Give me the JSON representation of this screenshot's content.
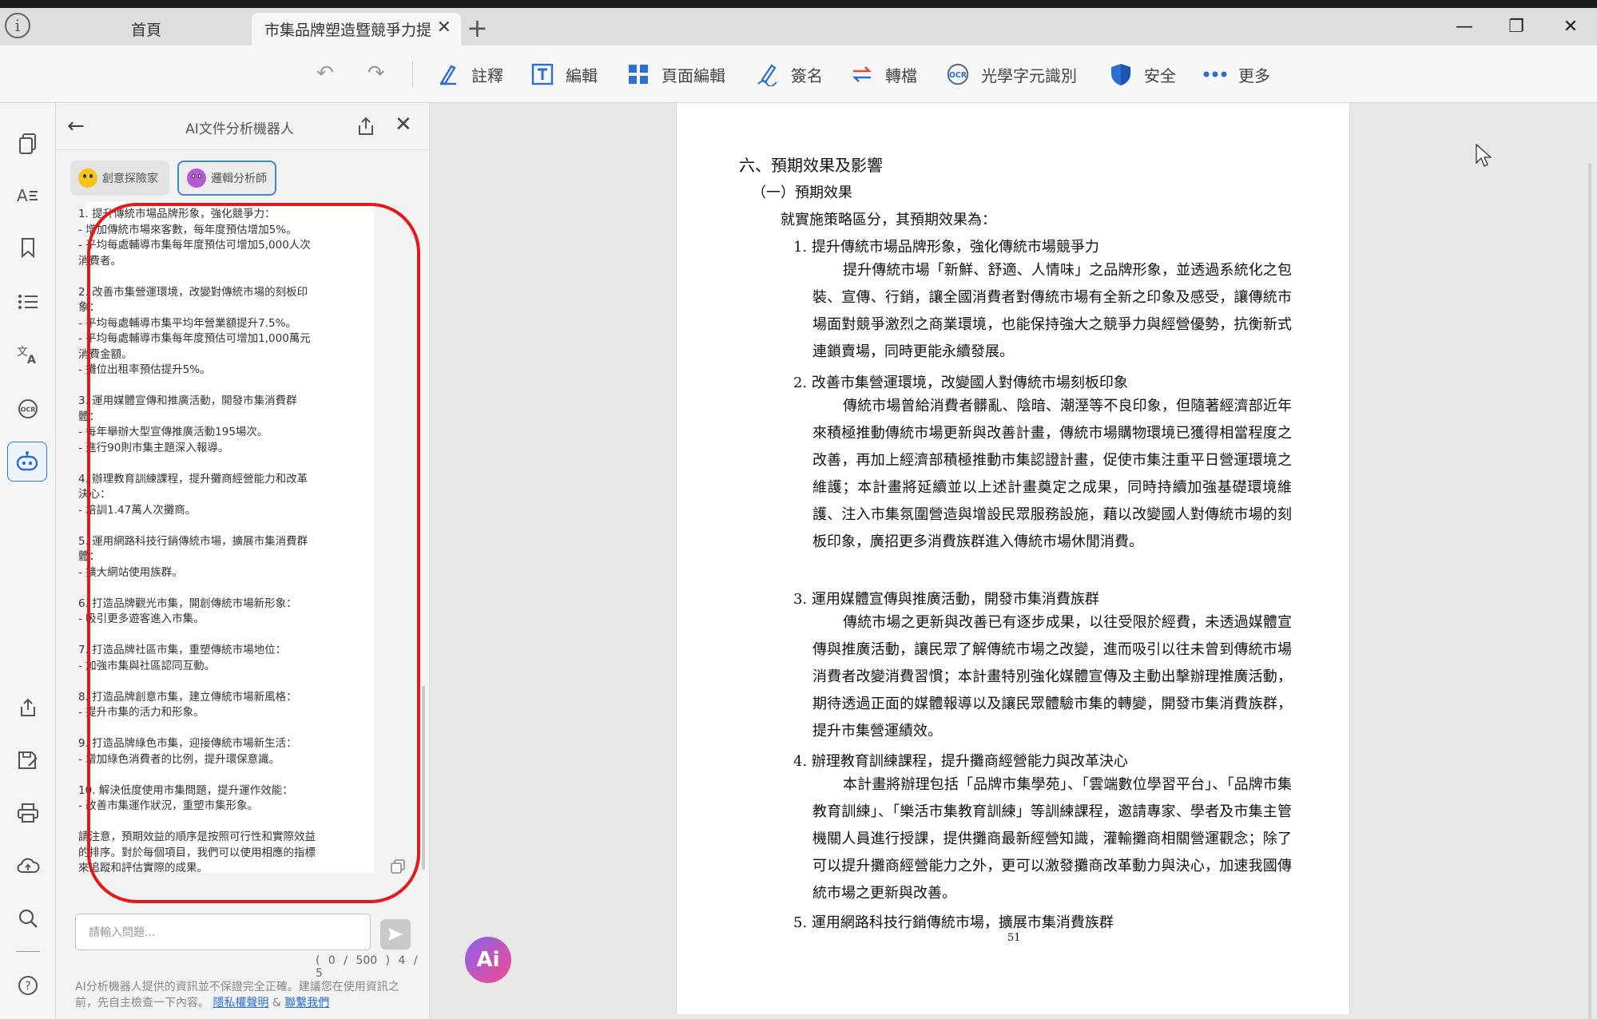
{
  "tabs": {
    "home": "首頁",
    "active": "市集品牌塑造暨競爭力提...",
    "add": "+",
    "close": "✕"
  },
  "window_controls": {
    "minimize": "—",
    "restore": "❐",
    "close": "✕"
  },
  "toolbar": {
    "annotate": "註釋",
    "edit": "編輯",
    "page_edit": "頁面編輯",
    "sign": "簽名",
    "convert": "轉檔",
    "ocr": "光學字元識別",
    "security": "安全",
    "more": "更多"
  },
  "panel": {
    "title": "AI文件分析機器人",
    "persona_creative": "創意探險家",
    "persona_logic": "邏輯分析師",
    "response": "1. 提升傳統市場品牌形象，強化競爭力：\n- 增加傳統市場來客數，每年度預估增加5%。\n- 平均每處輔導市集每年度預估可增加5,000人次\n消費者。\n\n2. 改善市集營運環境，改變對傳統市場的刻板印\n象：\n- 平均每處輔導市集平均年營業額提升7.5%。\n- 平均每處輔導市集每年度預估可增加1,000萬元\n消費金額。\n- 攤位出租率預估提升5%。\n\n3. 運用媒體宣傳和推廣活動，開發市集消費群\n體：\n- 每年舉辦大型宣傳推廣活動195場次。\n- 進行90則市集主題深入報導。\n\n4. 辦理教育訓練課程，提升攤商經營能力和改革\n決心：\n- 培訓1.47萬人次攤商。\n\n5. 運用網路科技行銷傳統市場，擴展市集消費群\n體：\n- 擴大網站使用族群。\n\n6. 打造品牌觀光市集，開創傳統市場新形象：\n- 吸引更多遊客進入市集。\n\n7. 打造品牌社區市集，重塑傳統市場地位：\n- 加強市集與社區認同互動。\n\n8. 打造品牌創意市集，建立傳統市場新風格：\n- 提升市集的活力和形象。\n\n9. 打造品牌綠色市集，迎接傳統市場新生活：\n- 增加綠色消費者的比例，提升環保意識。\n\n10. 解決低度使用市集問題，提升運作效能：\n- 改善市集運作狀況，重塑市集形象。\n\n請注意，預期效益的順序是按照可行性和實際效益\n的排序。對於每個項目，我們可以使用相應的指標\n來追蹤和評估實際的成果。",
    "input_placeholder": "請輸入問題...",
    "char_count": "( 0 / 500 )",
    "page_count": "4 / 5",
    "disclaimer": "AI分析機器人提供的資訊並不保證完全正確。建議您在使用資訊之前，先自主檢查一下內容。",
    "privacy_link": "隱私權聲明",
    "and": "&",
    "contact_link": "聯繫我們"
  },
  "ai_button": "Ai",
  "document": {
    "heading": "六、預期效果及影響",
    "sub1": "（一）預期效果",
    "intro": "就實施策略區分，其預期效果為：",
    "item1_title": "1. 提升傳統市場品牌形象，強化傳統市場競爭力",
    "item1_body": "提升傳統市場「新鮮、舒適、人情味」之品牌形象，並透過系統化之包裝、宣傳、行銷，讓全國消費者對傳統市場有全新之印象及感受，讓傳統市場面對競爭激烈之商業環境，也能保持強大之競爭力與經營優勢，抗衡新式連鎖賣場，同時更能永續發展。",
    "item2_title": "2. 改善市集營運環境，改變國人對傳統市場刻板印象",
    "item2_body": "傳統市場曾給消費者髒亂、陰暗、潮溼等不良印象，但隨著經濟部近年來積極推動傳統市場更新與改善計畫，傳統市場購物環境已獲得相當程度之改善，再加上經濟部積極推動市集認證計畫，促使市集注重平日營運環境之維護；本計畫將延續並以上述計畫奠定之成果，同時持續加強基礎環境維護、注入市集氛圍營造與增設民眾服務設施，藉以改變國人對傳統市場的刻板印象，廣招更多消費族群進入傳統市場休閒消費。",
    "item3_title": "3. 運用媒體宣傳與推廣活動，開發市集消費族群",
    "item3_body": "傳統市場之更新與改善已有逐步成果，以往受限於經費，未透過媒體宣傳與推廣活動，讓民眾了解傳統市場之改變，進而吸引以往未曾到傳統市場消費者改變消費習慣；本計畫特別強化媒體宣傳及主動出擊辦理推廣活動，期待透過正面的媒體報導以及讓民眾體驗市集的轉變，開發市集消費族群，提升市集營運績效。",
    "item4_title": "4. 辦理教育訓練課程，提升攤商經營能力與改革決心",
    "item4_body": "本計畫將辦理包括「品牌市集學苑」、「雲端數位學習平台」、「品牌市集教育訓練」、「樂活市集教育訓練」等訓練課程，邀請專家、學者及市集主管機關人員進行授課，提供攤商最新經營知識，灌輸攤商相關營運觀念；除了可以提升攤商經營能力之外，更可以激發攤商改革動力與決心，加速我國傳統市場之更新與改善。",
    "item5_title": "5. 運用網路科技行銷傳統市場，擴展市集消費族群",
    "page_number": "51"
  }
}
